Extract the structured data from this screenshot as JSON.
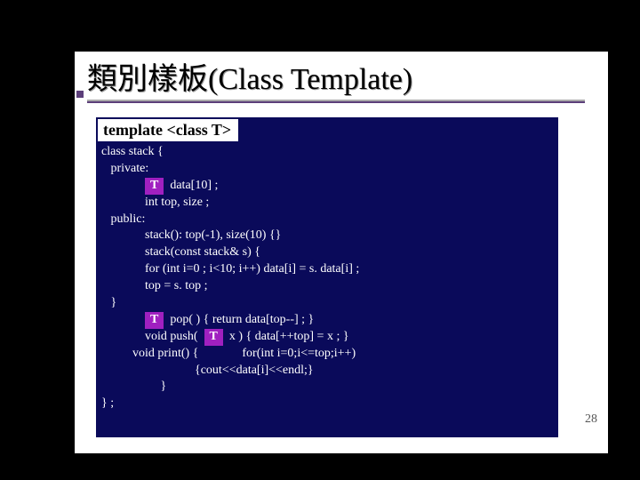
{
  "title": "類別樣板(Class Template)",
  "template_decl": "template <class T>",
  "type_param": "T",
  "code": {
    "l1": "class stack {",
    "l2": "   private:",
    "l3a": "              ",
    "l3b": "  data[10] ;",
    "l4": "              int top, size ;",
    "l5": "   public:",
    "l6": "              stack(): top(-1), size(10) {}",
    "l7": "              stack(const stack& s) {",
    "l8": "              for (int i=0 ; i<10; i++) data[i] = s. data[i] ;",
    "l9": "              top = s. top ;",
    "l10": "   }",
    "l11a": "              ",
    "l11b": "  pop( ) { return data[top--] ; }",
    "l12a": "              void push(  ",
    "l12b": "  x ) { data[++top] = x ; }",
    "l13": "          void print() {              for(int i=0;i<=top;i++)",
    "l14": "                              {cout<<data[i]<<endl;}",
    "l15": "                   }",
    "l16": "} ;"
  },
  "page_number": "28"
}
